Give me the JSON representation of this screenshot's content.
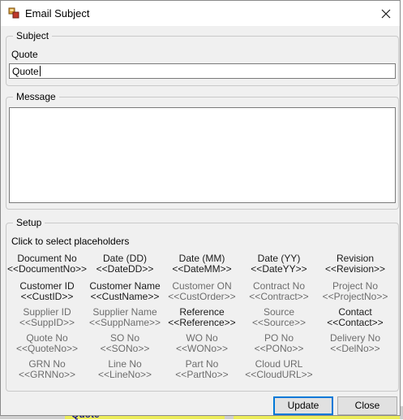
{
  "window": {
    "title": "Email Subject",
    "close_icon": "close-icon",
    "app_icon": "app-icon"
  },
  "subject": {
    "group_label": "Subject",
    "field_label": "Quote",
    "value": "Quote"
  },
  "message": {
    "group_label": "Message",
    "value": ""
  },
  "setup": {
    "group_label": "Setup",
    "instruction": "Click to select placeholders",
    "placeholders": [
      {
        "title": "Document No",
        "code": "<<DocumentNo>>",
        "enabled": true
      },
      {
        "title": "Date (DD)",
        "code": "<<DateDD>>",
        "enabled": true
      },
      {
        "title": "Date (MM)",
        "code": "<<DateMM>>",
        "enabled": true
      },
      {
        "title": "Date (YY)",
        "code": "<<DateYY>>",
        "enabled": true
      },
      {
        "title": "Revision",
        "code": "<<Revision>>",
        "enabled": true
      },
      {
        "title": "Customer ID",
        "code": "<<CustID>>",
        "enabled": true
      },
      {
        "title": "Customer Name",
        "code": "<<CustName>>",
        "enabled": true
      },
      {
        "title": "Customer ON",
        "code": "<<CustOrder>>",
        "enabled": false
      },
      {
        "title": "Contract No",
        "code": "<<Contract>>",
        "enabled": false
      },
      {
        "title": "Project No",
        "code": "<<ProjectNo>>",
        "enabled": false
      },
      {
        "title": "Supplier ID",
        "code": "<<SuppID>>",
        "enabled": false
      },
      {
        "title": "Supplier Name",
        "code": "<<SuppName>>",
        "enabled": false
      },
      {
        "title": "Reference",
        "code": "<<Reference>>",
        "enabled": true
      },
      {
        "title": "Source",
        "code": "<<Source>>",
        "enabled": false
      },
      {
        "title": "Contact",
        "code": "<<Contact>>",
        "enabled": true
      },
      {
        "title": "Quote No",
        "code": "<<QuoteNo>>",
        "enabled": false
      },
      {
        "title": "SO No",
        "code": "<<SONo>>",
        "enabled": false
      },
      {
        "title": "WO No",
        "code": "<<WONo>>",
        "enabled": false
      },
      {
        "title": "PO No",
        "code": "<<PONo>>",
        "enabled": false
      },
      {
        "title": "Delivery No",
        "code": "<<DelNo>>",
        "enabled": false
      },
      {
        "title": "GRN No",
        "code": "<<GRNNo>>",
        "enabled": false
      },
      {
        "title": "Line No",
        "code": "<<LineNo>>",
        "enabled": false
      },
      {
        "title": "Part No",
        "code": "<<PartNo>>",
        "enabled": false
      },
      {
        "title": "Cloud URL",
        "code": "<<CloudURL>>",
        "enabled": false
      }
    ]
  },
  "buttons": {
    "update": "Update",
    "close": "Close"
  },
  "background": {
    "visible_text": "Quote"
  },
  "colors": {
    "enabled_text": "#1a1a1a",
    "disabled_text": "#6d6d6d",
    "default_button_border": "#0078d7",
    "background_highlight": "#ecec5a"
  }
}
